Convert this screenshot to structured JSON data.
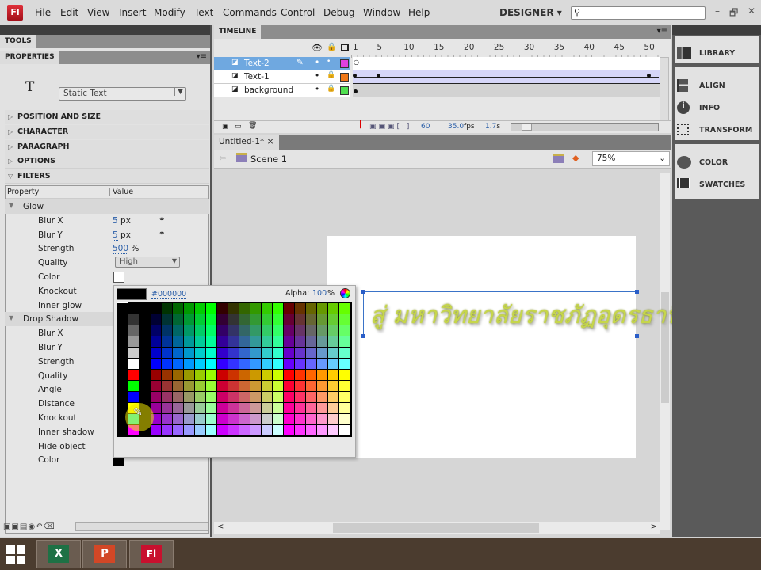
{
  "app": {
    "logo": "Fl",
    "workspace": "DESIGNER",
    "window_buttons": [
      "–",
      "🗗",
      "✕"
    ]
  },
  "menu": [
    "File",
    "Edit",
    "View",
    "Insert",
    "Modify",
    "Text",
    "Commands",
    "Control",
    "Debug",
    "Window",
    "Help"
  ],
  "left": {
    "tools_tab": "TOOLS",
    "properties_tab": "PROPERTIES",
    "tool_glyph": "T",
    "text_type": "Static Text",
    "sections": [
      "POSITION AND SIZE",
      "CHARACTER",
      "PARAGRAPH",
      "OPTIONS",
      "FILTERS"
    ],
    "columns": {
      "property": "Property",
      "value": "Value"
    },
    "glow": {
      "name": "Glow",
      "rows": [
        {
          "label": "Blur X",
          "value": "5",
          "unit": "px"
        },
        {
          "label": "Blur Y",
          "value": "5",
          "unit": "px"
        },
        {
          "label": "Strength",
          "value": "500",
          "unit": "%"
        },
        {
          "label": "Quality",
          "value": "High"
        },
        {
          "label": "Color",
          "color": "#ffffff"
        },
        {
          "label": "Knockout"
        },
        {
          "label": "Inner glow"
        }
      ]
    },
    "drop_shadow": {
      "name": "Drop Shadow",
      "rows": [
        "Blur X",
        "Blur Y",
        "Strength",
        "Quality",
        "Angle",
        "Distance",
        "Knockout",
        "Inner shadow",
        "Hide object",
        "Color"
      ],
      "color": "#000000"
    }
  },
  "timeline": {
    "title": "TIMELINE",
    "ruler": [
      "1",
      "5",
      "10",
      "15",
      "20",
      "25",
      "30",
      "35",
      "40",
      "45",
      "50"
    ],
    "layers": [
      {
        "name": "Text-2",
        "color": "#e040e0",
        "selected": true
      },
      {
        "name": "Text-1",
        "color": "#f07818"
      },
      {
        "name": "background",
        "color": "#50e050"
      }
    ],
    "current_frame": "60",
    "fps": "35.0",
    "fps_unit": "fps",
    "time": "1.7",
    "time_unit": "s"
  },
  "document": {
    "tab": "Untitled-1*",
    "close": "×",
    "scene": "Scene 1",
    "zoom": "75%"
  },
  "stage_text": "สู่ มหาวิทยาลัยราชภัฏอุดรธานี",
  "color_picker": {
    "hex": "#000000",
    "alpha_label": "Alpha:",
    "alpha": "100",
    "alpha_unit": "%"
  },
  "dock": [
    "LIBRARY",
    "ALIGN",
    "INFO",
    "TRANSFORM",
    "COLOR",
    "SWATCHES"
  ],
  "taskbar": [
    "X",
    "P",
    "Fl"
  ]
}
